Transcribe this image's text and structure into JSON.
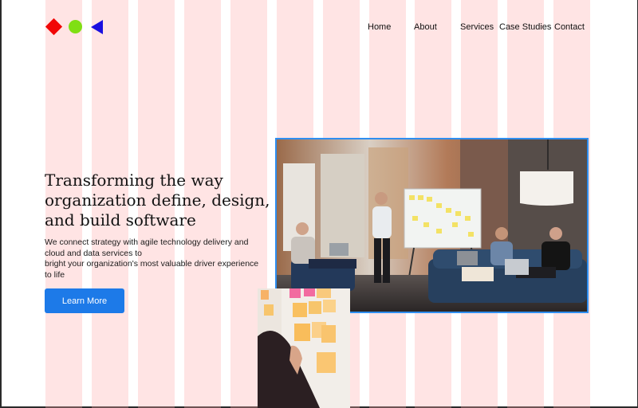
{
  "nav": {
    "items": [
      {
        "label": "Home"
      },
      {
        "label": "About"
      },
      {
        "label": "Services"
      },
      {
        "label": "Case Studies"
      },
      {
        "label": "Contact"
      }
    ]
  },
  "hero": {
    "title_lines": [
      "Transforming the way",
      "organization define, design,",
      "and build software"
    ],
    "description_lines": [
      "We connect strategy with agile technology delivery and",
      "cloud and data services to",
      "bright your organization's most valuable driver experience",
      "to life"
    ],
    "cta_label": "Learn More"
  },
  "colors": {
    "logo_diamond": "#f10606",
    "logo_circle": "#80df13",
    "logo_triangle": "#1a0fe0",
    "cta": "#1d7ae8",
    "image_border": "#2f8ef0",
    "grid_overlay": "#ffaaaa"
  },
  "images": {
    "main_photo": "team-meeting-office-photo",
    "secondary_photo": "sticky-notes-wall-photo"
  }
}
